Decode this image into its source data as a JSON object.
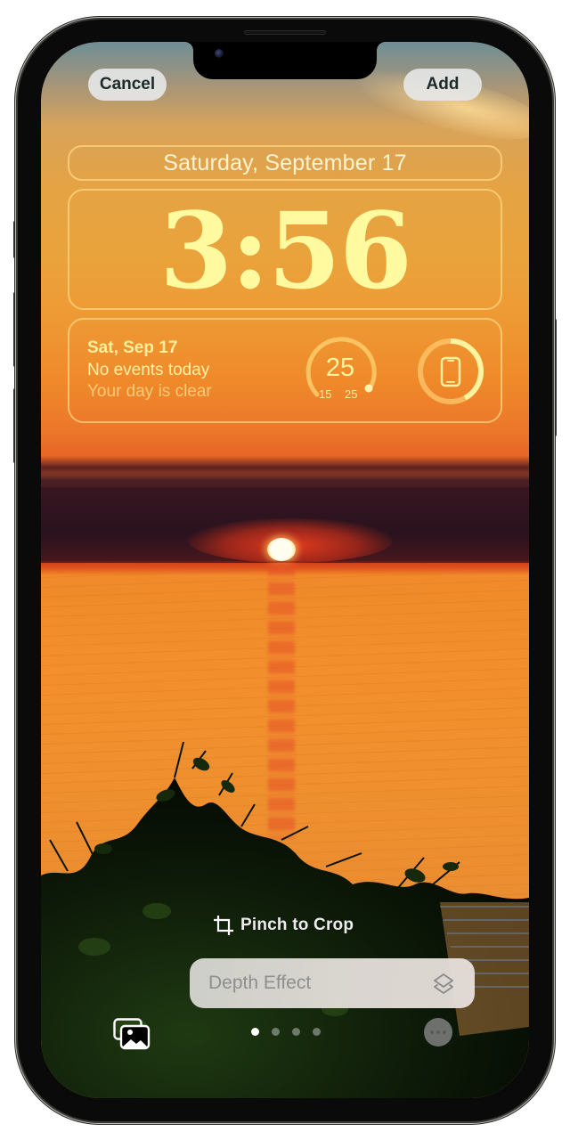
{
  "top_bar": {
    "cancel_label": "Cancel",
    "add_label": "Add"
  },
  "lock_screen": {
    "date": "Saturday, September 17",
    "time": "3:56",
    "accent_color": "#fffaa0"
  },
  "widgets": {
    "calendar": {
      "date": "Sat, Sep 17",
      "events": "No events today",
      "subtitle": "Your day is clear"
    },
    "weather": {
      "current_temp": "25",
      "low": "15",
      "high": "25",
      "icon": "temperature-gauge"
    },
    "battery": {
      "icon": "iphone-icon",
      "level_fraction": 0.42
    }
  },
  "controls": {
    "crop_icon": "crop-icon",
    "pinch_label": "Pinch to Crop",
    "depth_effect_label": "Depth Effect",
    "depth_effect_icon": "layers-icon",
    "gallery_icon": "photo-library-icon",
    "more_icon": "ellipsis-icon",
    "page_dots": {
      "count": 4,
      "active_index": 0
    }
  }
}
